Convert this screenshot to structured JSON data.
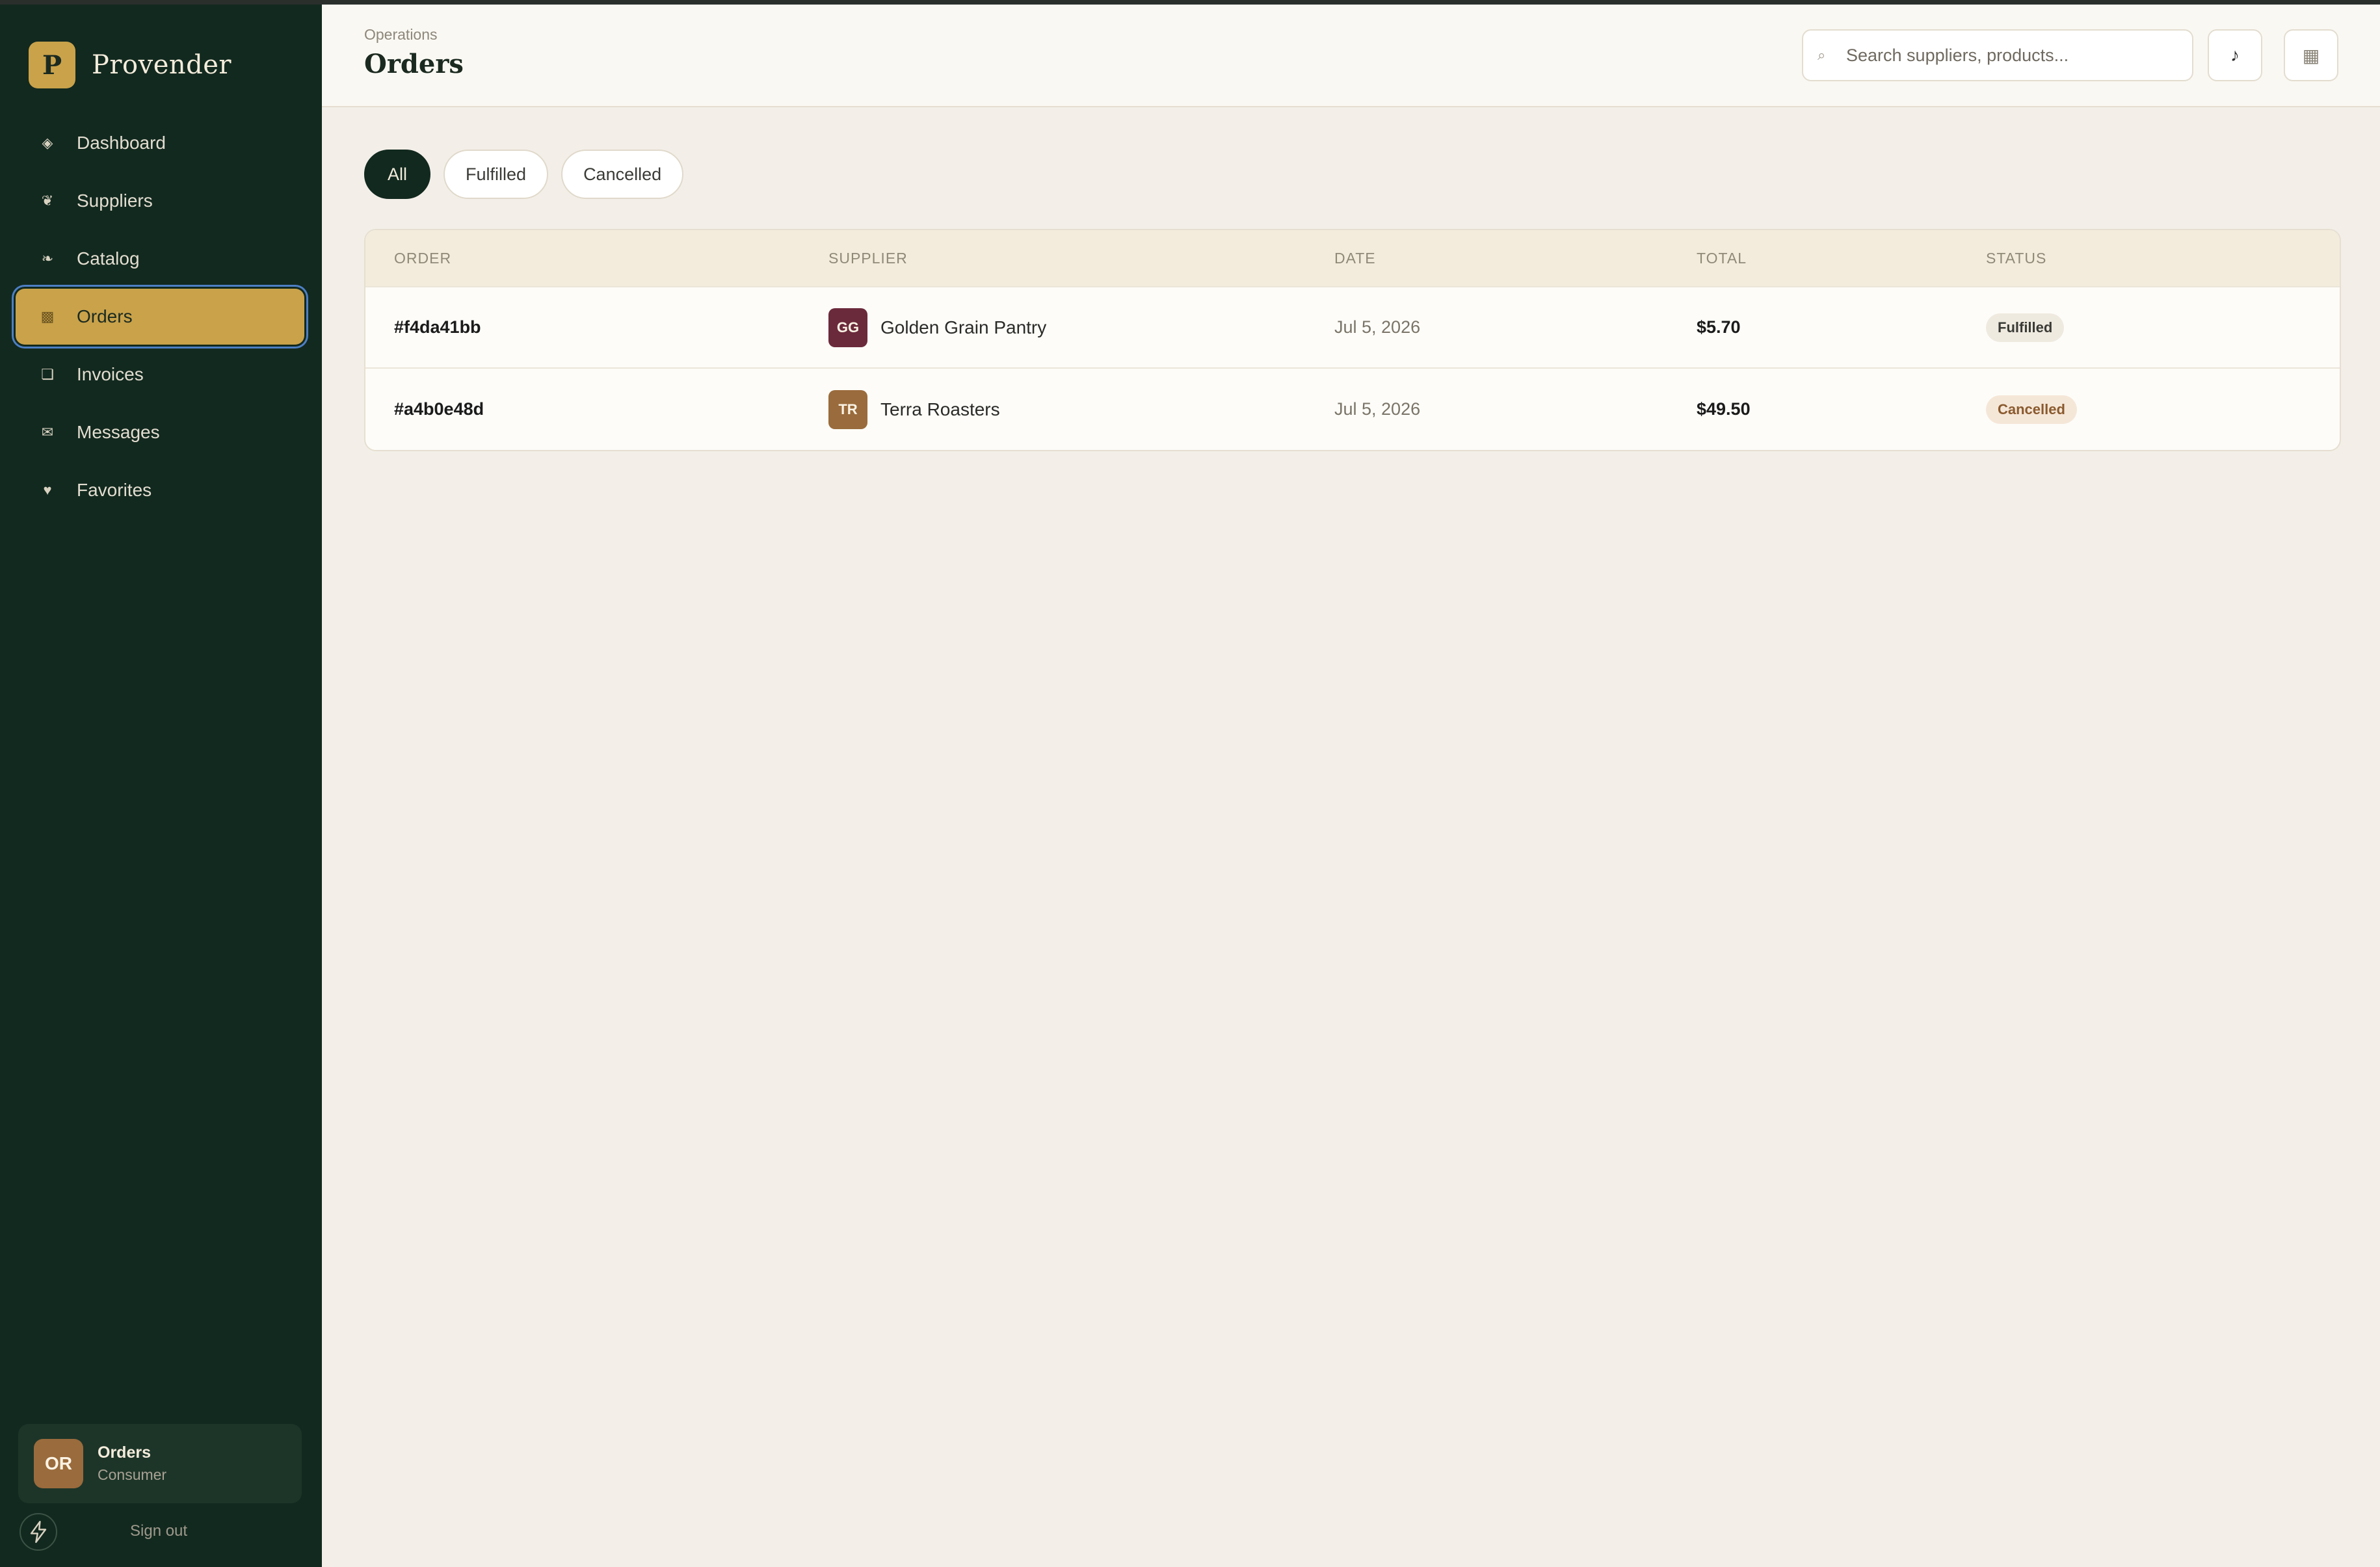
{
  "brand": {
    "logo_letter": "P",
    "name": "Provender"
  },
  "sidebar": {
    "items": [
      {
        "label": "Dashboard",
        "icon": "diamond-icon",
        "glyph": "◈"
      },
      {
        "label": "Suppliers",
        "icon": "apple-icon",
        "glyph": "❦"
      },
      {
        "label": "Catalog",
        "icon": "leaf-icon",
        "glyph": "❧"
      },
      {
        "label": "Orders",
        "icon": "box-icon",
        "glyph": "▩"
      },
      {
        "label": "Invoices",
        "icon": "document-icon",
        "glyph": "❏"
      },
      {
        "label": "Messages",
        "icon": "envelope-icon",
        "glyph": "✉"
      },
      {
        "label": "Favorites",
        "icon": "heart-icon",
        "glyph": "♥"
      }
    ],
    "active": "Orders"
  },
  "user": {
    "initials": "OR",
    "name": "Orders",
    "role": "Consumer",
    "sign_out": "Sign out"
  },
  "header": {
    "breadcrumb": "Operations",
    "title": "Orders",
    "search_placeholder": "Search suppliers, products...",
    "music_glyph": "♪",
    "grid_glyph": "▦"
  },
  "filters": [
    {
      "label": "All",
      "active": true
    },
    {
      "label": "Fulfilled",
      "active": false
    },
    {
      "label": "Cancelled",
      "active": false
    }
  ],
  "table": {
    "columns": [
      "ORDER",
      "SUPPLIER",
      "DATE",
      "TOTAL",
      "STATUS"
    ],
    "rows": [
      {
        "order": "#f4da41bb",
        "supplier_initials": "GG",
        "supplier": "Golden Grain Pantry",
        "supplier_color": "#6b2a3c",
        "date": "Jul 5, 2026",
        "total": "$5.70",
        "status": "Fulfilled"
      },
      {
        "order": "#a4b0e48d",
        "supplier_initials": "TR",
        "supplier": "Terra Roasters",
        "supplier_color": "#9a6b3c",
        "date": "Jul 5, 2026",
        "total": "$49.50",
        "status": "Cancelled"
      }
    ]
  },
  "colors": {
    "sidebar_bg": "#12291f",
    "accent_gold": "#c9a24a",
    "fulfilled_bg": "#efeae0",
    "fulfilled_fg": "#3a3a36",
    "cancelled_bg": "#f5e7d8",
    "cancelled_fg": "#8a5a2e"
  }
}
